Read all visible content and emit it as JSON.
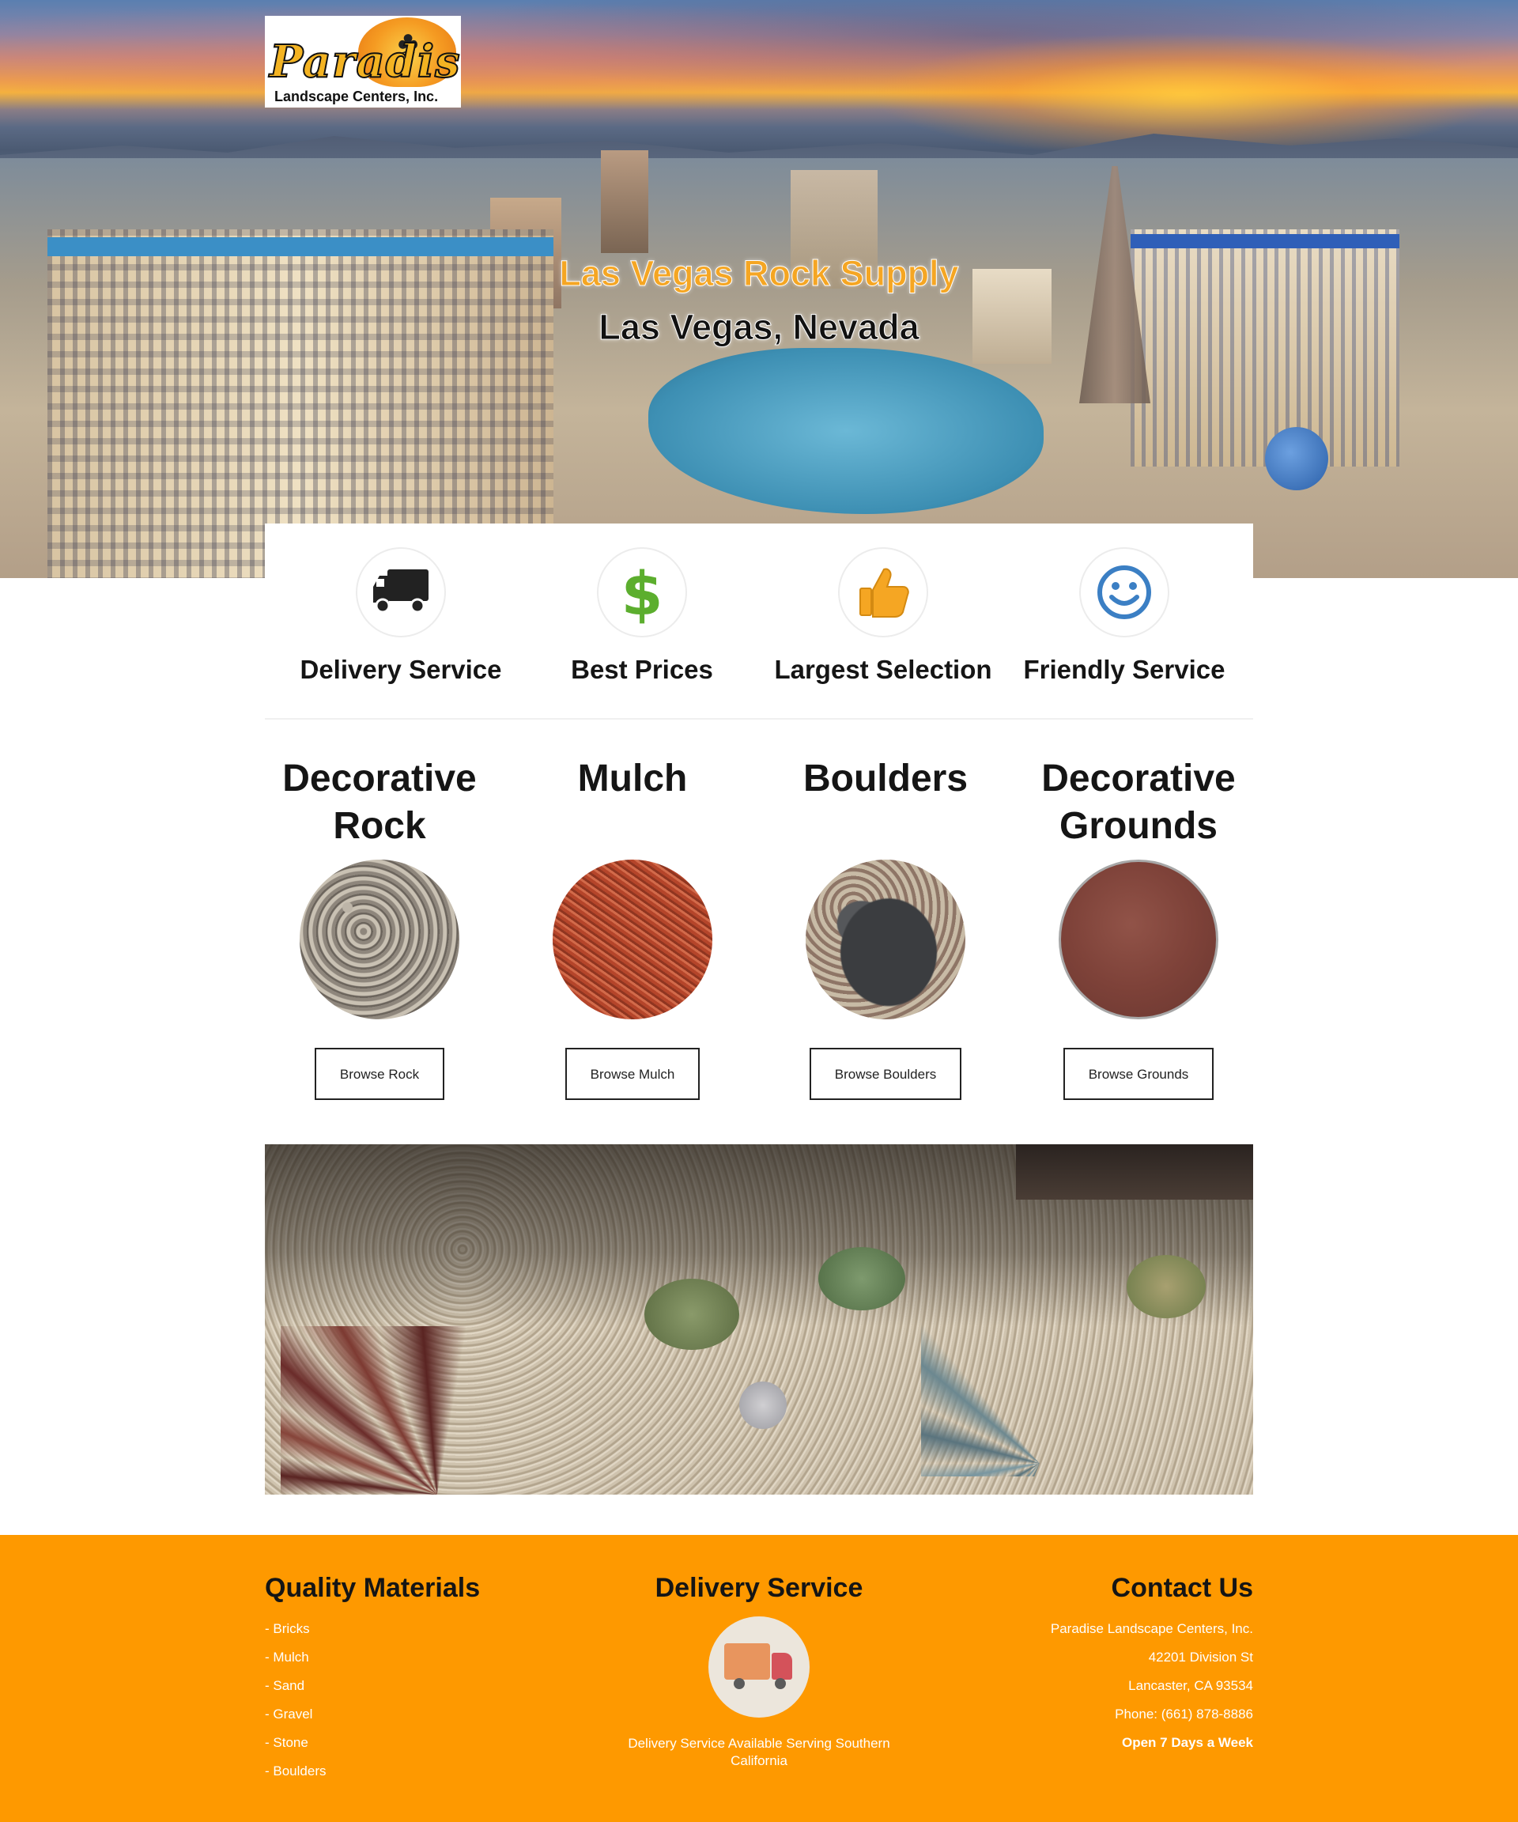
{
  "header": {
    "logo_script": "Paradise",
    "logo_sub": "Landscape Centers, Inc.",
    "title": "Las Vegas Rock Supply",
    "subtitle": "Las Vegas, Nevada"
  },
  "features": [
    {
      "label": "Delivery Service",
      "icon": "truck-icon",
      "color": "#222222"
    },
    {
      "label": "Best Prices",
      "icon": "dollar-icon",
      "color": "#5cae2e"
    },
    {
      "label": "Largest Selection",
      "icon": "thumbs-up-icon",
      "color": "#f5a623"
    },
    {
      "label": "Friendly Service",
      "icon": "smiley-icon",
      "color": "#3b7fc4"
    }
  ],
  "products": [
    {
      "title": "Decorative Rock",
      "button": "Browse Rock"
    },
    {
      "title": "Mulch",
      "button": "Browse Mulch"
    },
    {
      "title": "Boulders",
      "button": "Browse Boulders"
    },
    {
      "title": "Decorative Grounds",
      "button": "Browse Grounds"
    }
  ],
  "footer": {
    "accent_color": "#fe9900",
    "materials": {
      "heading": "Quality Materials",
      "items": [
        "- Bricks",
        "- Mulch",
        "- Sand",
        "- Gravel",
        "- Stone",
        "- Boulders"
      ]
    },
    "delivery": {
      "heading": "Delivery Service",
      "icon": "delivery-truck-icon",
      "text": "Delivery Service Available Serving Southern California"
    },
    "contact": {
      "heading": "Contact Us",
      "company": "Paradise Landscape Centers, Inc.",
      "street": "42201 Division St",
      "city": "Lancaster, CA 93534",
      "phone": "Phone: (661) 878-8886",
      "hours": "Open 7 Days a Week"
    }
  }
}
